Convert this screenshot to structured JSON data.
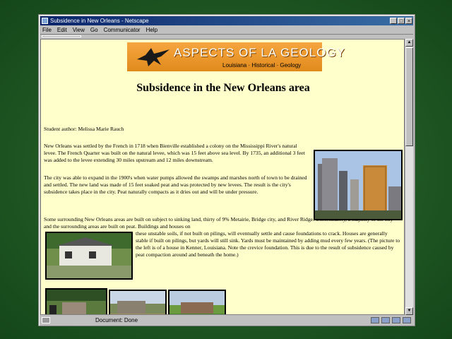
{
  "window": {
    "title": "Subsidence in New Orleans - Netscape",
    "controls": [
      "_",
      "□",
      "×"
    ]
  },
  "menu": [
    "File",
    "Edit",
    "View",
    "Go",
    "Communicator",
    "Help"
  ],
  "banner": {
    "title": "ASPECTS OF LA GEOLOGY",
    "subtitle": "Louisiana  ·  Historical  ·  Geology"
  },
  "page": {
    "heading": "Subsidence in the New Orleans area",
    "author": "Student author: Melissa Marie Rauch",
    "p1": "New Orleans was settled by the French in 1718 when Bienville established a colony on the Mississippi River's natural levee. The French Quarter was built on the natural levee, which was 15 feet above sea level. By 1735, an additional 3 feet was added to the levee extending 30 miles upstream and 12 miles downstream.",
    "p2": "The city was able to expand in the 1900's when water pumps allowed the swamps and marshes north of town to be drained and settled. The new land was made of 15 feet soaked peat and was protected by new levees. The result is the city's subsidence takes place in the city. Peat naturally compacts as it dries out and will be under pressure.",
    "p3a": "Some surrounding New Orleans areas are built on subject to sinking land, thirty of 9% Metairie, Bridge city, and River Ridge. Unfortunately, a majority of the city and the surrounding areas are built on peat. Buildings and houses on",
    "p3b": "these unstable soils, if not built on pilings, will eventually settle and cause foundations to crack. Houses are generally stable if built on pilings, but yards will still sink. Yards must be maintained by adding mud every few years. (The picture to the left is of a house in Kenner, Louisiana. Note the crevice foundation. This is due to the result of subsidence caused by peat compaction around and beneath the home.)"
  },
  "status": {
    "text": "Document: Done"
  }
}
